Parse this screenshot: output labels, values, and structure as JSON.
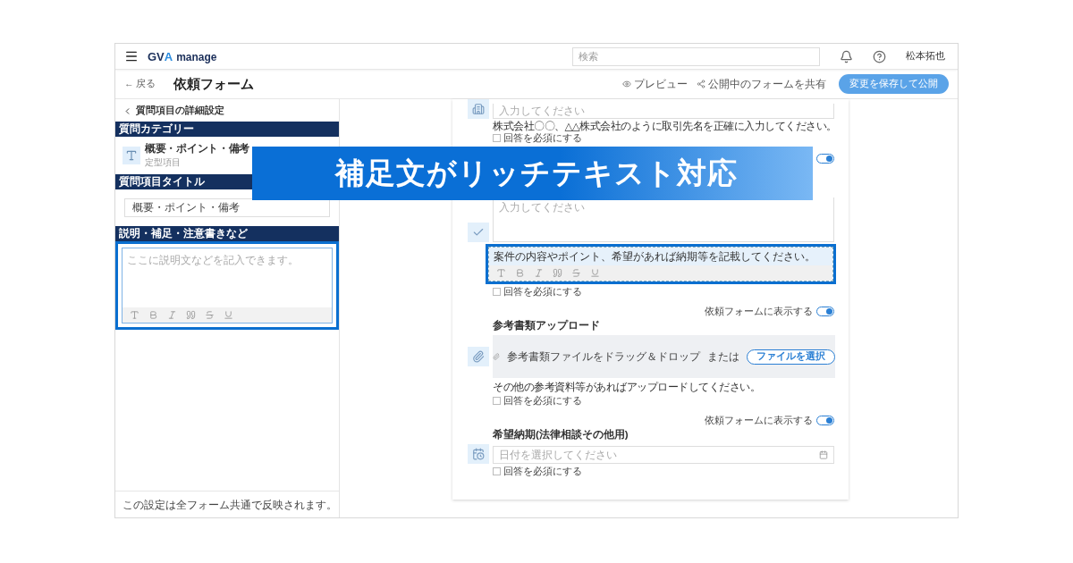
{
  "header": {
    "logo": {
      "mark": "GV",
      "accent": "A",
      "product": "manage"
    },
    "search": {
      "placeholder": "検索"
    },
    "user": "松本拓也"
  },
  "subheader": {
    "back": "← 戻る",
    "title": "依頼フォーム",
    "preview": "プレビュー",
    "share": "公開中のフォームを共有",
    "publish": "変更を保存して公開"
  },
  "settings_panel": {
    "back": "質問項目の詳細設定",
    "sections": [
      {
        "kind": "category",
        "heading": "質問カテゴリー",
        "name": "概要・ポイント・備考",
        "sub": "定型項目"
      },
      {
        "kind": "input",
        "heading": "質問項目タイトル",
        "value": "概要・ポイント・備考"
      },
      {
        "kind": "editor",
        "heading": "説明・補足・注意書きなど",
        "placeholder": "ここに説明文などを記入できます。",
        "highlighted": true
      }
    ],
    "footer": "この設定は全フォーム共通で反映されます。"
  },
  "form_items": [
    {
      "kind": "text_input",
      "placeholder": "入力してください",
      "helper": "株式会社〇〇、△△株式会社のように取引先名を正確に入力してください。",
      "required": {
        "label": "回答を必須にする",
        "checked": false
      }
    },
    {
      "kind": "textarea",
      "toggle": {
        "on": true
      },
      "placeholder": "入力してください",
      "helper": "案件の内容やポイント、希望があれば納期等を記載してください。",
      "highlighted": true,
      "required": {
        "label": "回答を必須にする",
        "checked": false
      }
    },
    {
      "kind": "file_upload",
      "toggle": {
        "label": "依頼フォームに表示する",
        "on": true
      },
      "title": "参考書類アップロード",
      "drop_text": "参考書類ファイルをドラッグ＆ドロップ",
      "or": "または",
      "button": "ファイルを選択",
      "helper": "その他の参考資料等があればアップロードしてください。",
      "required": {
        "label": "回答を必須にする",
        "checked": false
      }
    },
    {
      "kind": "date",
      "toggle": {
        "label": "依頼フォームに表示する",
        "on": true
      },
      "title": "希望納期(法律相談その他用)",
      "placeholder": "日付を選択してください",
      "required": {
        "label": "回答を必須にする",
        "checked": false
      }
    }
  ],
  "banner": {
    "text": "補足文がリッチテキスト対応"
  }
}
